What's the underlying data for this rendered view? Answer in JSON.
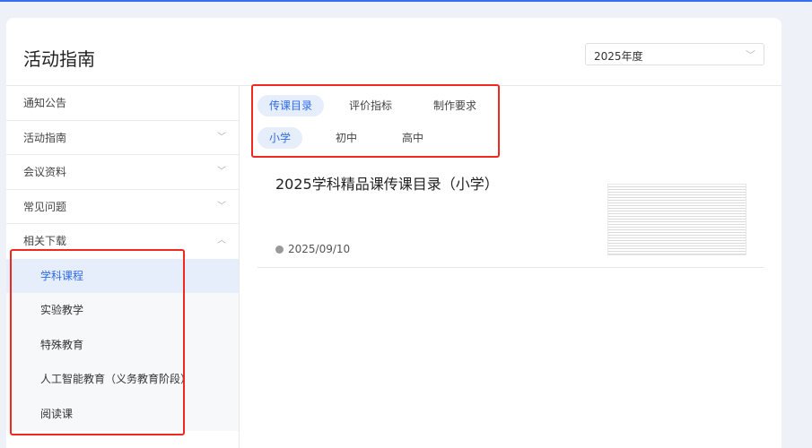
{
  "page": {
    "title": "活动指南",
    "year_select": "2025年度"
  },
  "sidebar": {
    "items": [
      {
        "label": "通知公告"
      },
      {
        "label": "活动指南"
      },
      {
        "label": "会议资料"
      },
      {
        "label": "常见问题"
      },
      {
        "label": "相关下载"
      }
    ],
    "sub_items": [
      {
        "label": "学科课程"
      },
      {
        "label": "实验教学"
      },
      {
        "label": "特殊教育"
      },
      {
        "label": "人工智能教育（义务教育阶段）"
      },
      {
        "label": "阅读课"
      }
    ]
  },
  "tabs": {
    "categories": [
      "传课目录",
      "评价指标",
      "制作要求"
    ],
    "levels": [
      "小学",
      "初中",
      "高中"
    ]
  },
  "list": [
    {
      "title": "2025学科精品课传课目录（小学）",
      "date": "2025/09/10"
    }
  ],
  "colors": {
    "accent": "#2f6ae5",
    "annotation": "#f0281e"
  }
}
